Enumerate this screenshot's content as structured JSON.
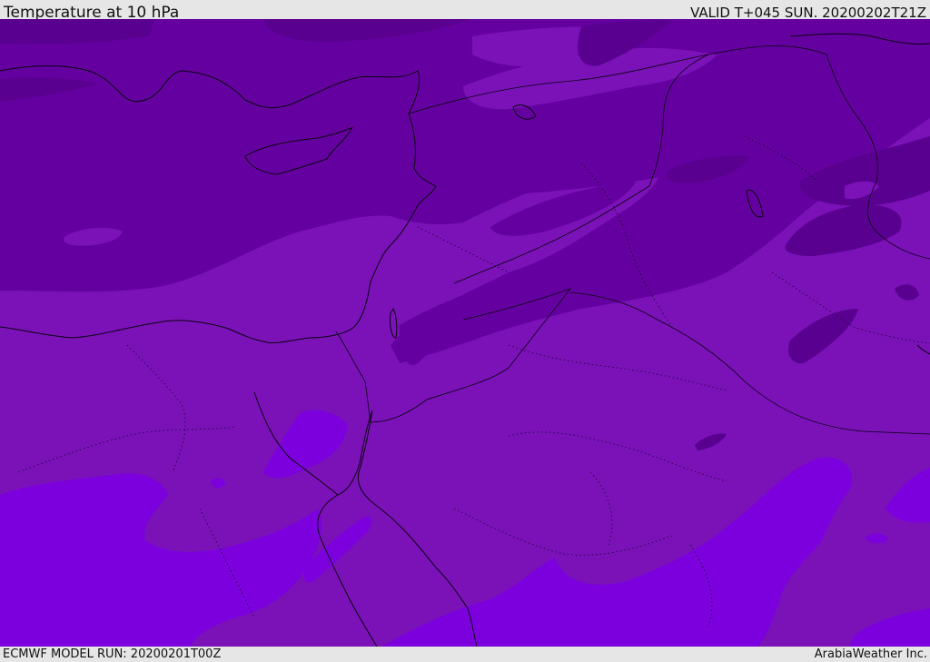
{
  "header": {
    "title": "Temperature at 10 hPa",
    "valid": "VALID T+045 SUN. 20200202T21Z"
  },
  "footer": {
    "model_run": "ECMWF MODEL RUN: 20200201T00Z",
    "credit": "ArabiaWeather Inc."
  },
  "map": {
    "colors": {
      "darkest": "#5a0090",
      "dark": "#6500a0",
      "mid": "#7a12b8",
      "light": "#7c00dd",
      "coast": "#0a0010"
    }
  }
}
